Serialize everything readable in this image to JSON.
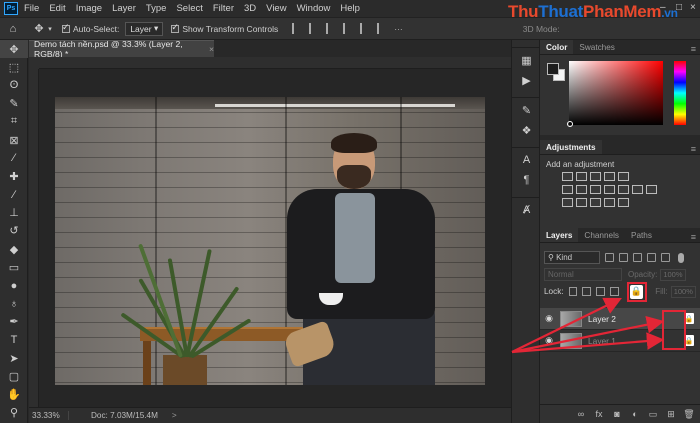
{
  "app": {
    "logo": "Ps"
  },
  "menu": [
    "File",
    "Edit",
    "Image",
    "Layer",
    "Type",
    "Select",
    "Filter",
    "3D",
    "View",
    "Window",
    "Help"
  ],
  "watermark": {
    "part1": "Thu",
    "part2": "Thuat",
    "part3": "PhanMem",
    "part4": ".vn",
    "colors": [
      "#e8492d",
      "#1d6fd1",
      "#e8492d",
      "#1d6fd1"
    ]
  },
  "options_bar": {
    "auto_select_label": "Auto-Select:",
    "auto_select_value": "Layer",
    "show_transform_label": "Show Transform Controls",
    "mode_3d": "3D Mode:"
  },
  "document": {
    "tab_title": "Demo tách nền.psd @ 33.3% (Layer 2, RGB/8) *",
    "close": "×"
  },
  "status": {
    "zoom": "33.33%",
    "doc_info": "Doc: 7.03M/15.4M",
    "arrow": ">"
  },
  "tools": [
    "move",
    "marquee",
    "lasso",
    "quick-select",
    "crop",
    "frame",
    "eyedropper",
    "healing",
    "brush",
    "stamp",
    "history-brush",
    "eraser",
    "gradient",
    "blur",
    "dodge",
    "pen",
    "type",
    "path-select",
    "shape",
    "hand",
    "zoom"
  ],
  "panels": {
    "color": {
      "tabs": [
        "Color",
        "Swatches"
      ],
      "foreground": "#1d1d1d",
      "background": "#f4f4f4"
    },
    "adjustments": {
      "tab": "Adjustments",
      "prompt": "Add an adjustment"
    },
    "layers": {
      "tabs": [
        "Layers",
        "Channels",
        "Paths"
      ],
      "kind": "Kind",
      "blend_mode": "Normal",
      "opacity_label": "Opacity:",
      "opacity_value": "100%",
      "lock_label": "Lock:",
      "fill_label": "Fill:",
      "fill_value": "100%",
      "items": [
        {
          "name": "Layer 2",
          "visible": true,
          "locked": true,
          "selected": true
        },
        {
          "name": "Layer 1",
          "visible": true,
          "locked": true,
          "selected": false
        }
      ]
    }
  },
  "annotation_color": "#e32636"
}
